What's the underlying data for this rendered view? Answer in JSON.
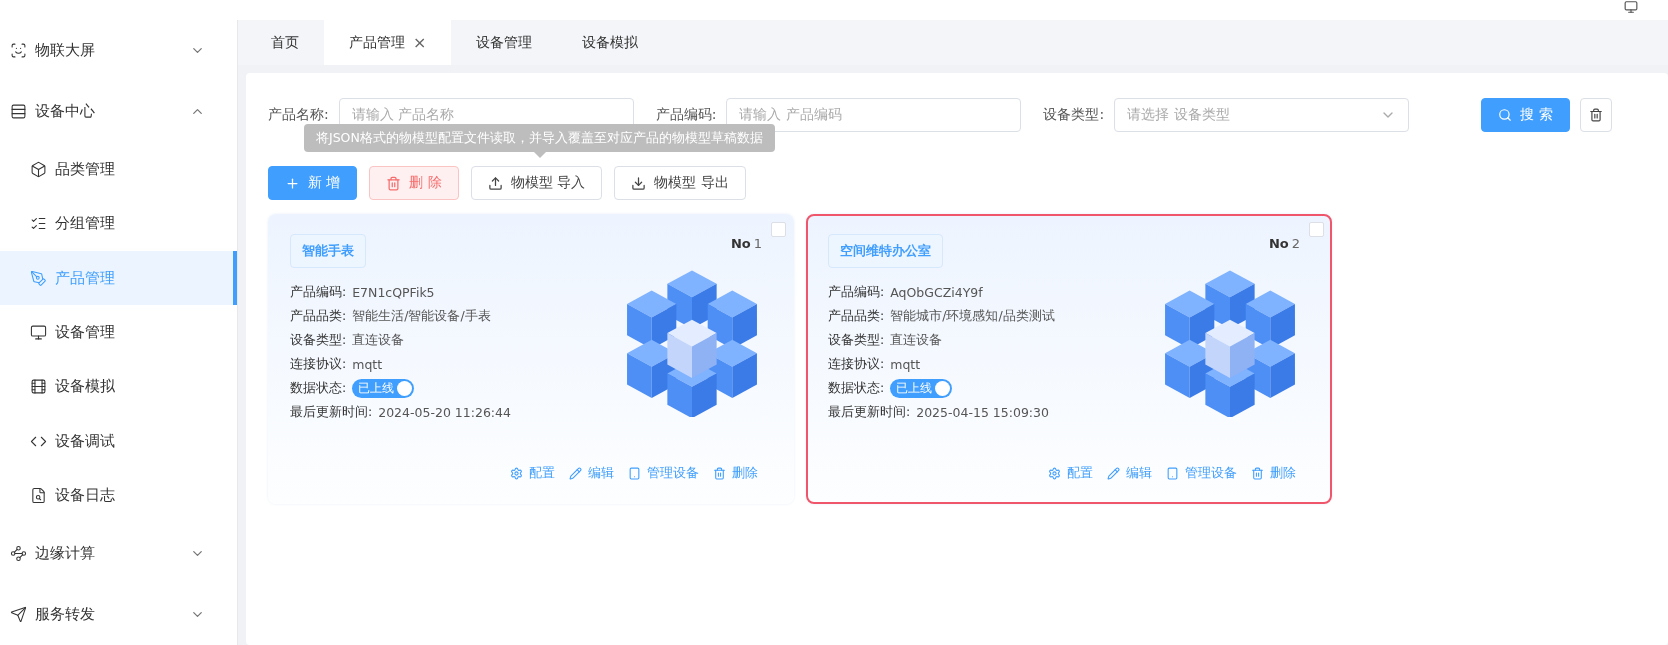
{
  "sidebar": {
    "items": [
      {
        "label": "物联大屏",
        "expanded": false,
        "selected": false
      },
      {
        "label": "设备中心",
        "expanded": true,
        "selected": false,
        "children": [
          {
            "label": "品类管理",
            "selected": false
          },
          {
            "label": "分组管理",
            "selected": false
          },
          {
            "label": "产品管理",
            "selected": true
          },
          {
            "label": "设备管理",
            "selected": false
          },
          {
            "label": "设备模拟",
            "selected": false
          },
          {
            "label": "设备调试",
            "selected": false
          },
          {
            "label": "设备日志",
            "selected": false
          }
        ]
      },
      {
        "label": "边缘计算",
        "expanded": false,
        "selected": false
      },
      {
        "label": "服务转发",
        "expanded": false,
        "selected": false
      }
    ]
  },
  "tabs": [
    {
      "label": "首页",
      "selected": false,
      "closable": false
    },
    {
      "label": "产品管理",
      "selected": true,
      "closable": true,
      "close": "×"
    },
    {
      "label": "设备管理",
      "selected": false,
      "closable": false
    },
    {
      "label": "设备模拟",
      "selected": false,
      "closable": false
    }
  ],
  "filters": [
    {
      "label": "产品名称:",
      "placeholder": "请输入 产品名称",
      "kind": "input"
    },
    {
      "label": "产品编码:",
      "placeholder": "请输入 产品编码",
      "kind": "input"
    },
    {
      "label": "设备类型:",
      "placeholder": "请选择 设备类型",
      "kind": "select"
    }
  ],
  "search_button": "搜 索",
  "tooltip": "将JSON格式的物模型配置文件读取，并导入覆盖至对应产品的物模型草稿数据",
  "toolbar": [
    {
      "label": "新 增",
      "kind": "primary"
    },
    {
      "label": "删 除",
      "kind": "danger"
    },
    {
      "label": "物模型 导入",
      "kind": "default"
    },
    {
      "label": "物模型 导出",
      "kind": "default"
    }
  ],
  "cards": [
    {
      "title": "智能手表",
      "no_label": "No",
      "no": "1",
      "checked": false,
      "highlighted": false,
      "fields": [
        {
          "label": "产品编码:",
          "value": "E7N1cQPFik5"
        },
        {
          "label": "产品品类:",
          "value": "智能生活/智能设备/手表"
        },
        {
          "label": "设备类型:",
          "value": "直连设备"
        },
        {
          "label": "连接协议:",
          "value": "mqtt"
        }
      ],
      "status": {
        "label": "数据状态:",
        "text": "已上线",
        "on": true
      },
      "updated": {
        "label": "最后更新时间:",
        "value": "2024-05-20 11:26:44"
      },
      "actions": [
        "配置",
        "编辑",
        "管理设备",
        "删除"
      ]
    },
    {
      "title": "空间维特办公室",
      "no_label": "No",
      "no": "2",
      "checked": false,
      "highlighted": true,
      "fields": [
        {
          "label": "产品编码:",
          "value": "AqObGCZi4Y9f"
        },
        {
          "label": "产品品类:",
          "value": "智能城市/环境感知/品类测试"
        },
        {
          "label": "设备类型:",
          "value": "直连设备"
        },
        {
          "label": "连接协议:",
          "value": "mqtt"
        }
      ],
      "status": {
        "label": "数据状态:",
        "text": "已上线",
        "on": true
      },
      "updated": {
        "label": "最后更新时间:",
        "value": "2025-04-15 15:09:30"
      },
      "actions": [
        "配置",
        "编辑",
        "管理设备",
        "删除"
      ]
    }
  ]
}
